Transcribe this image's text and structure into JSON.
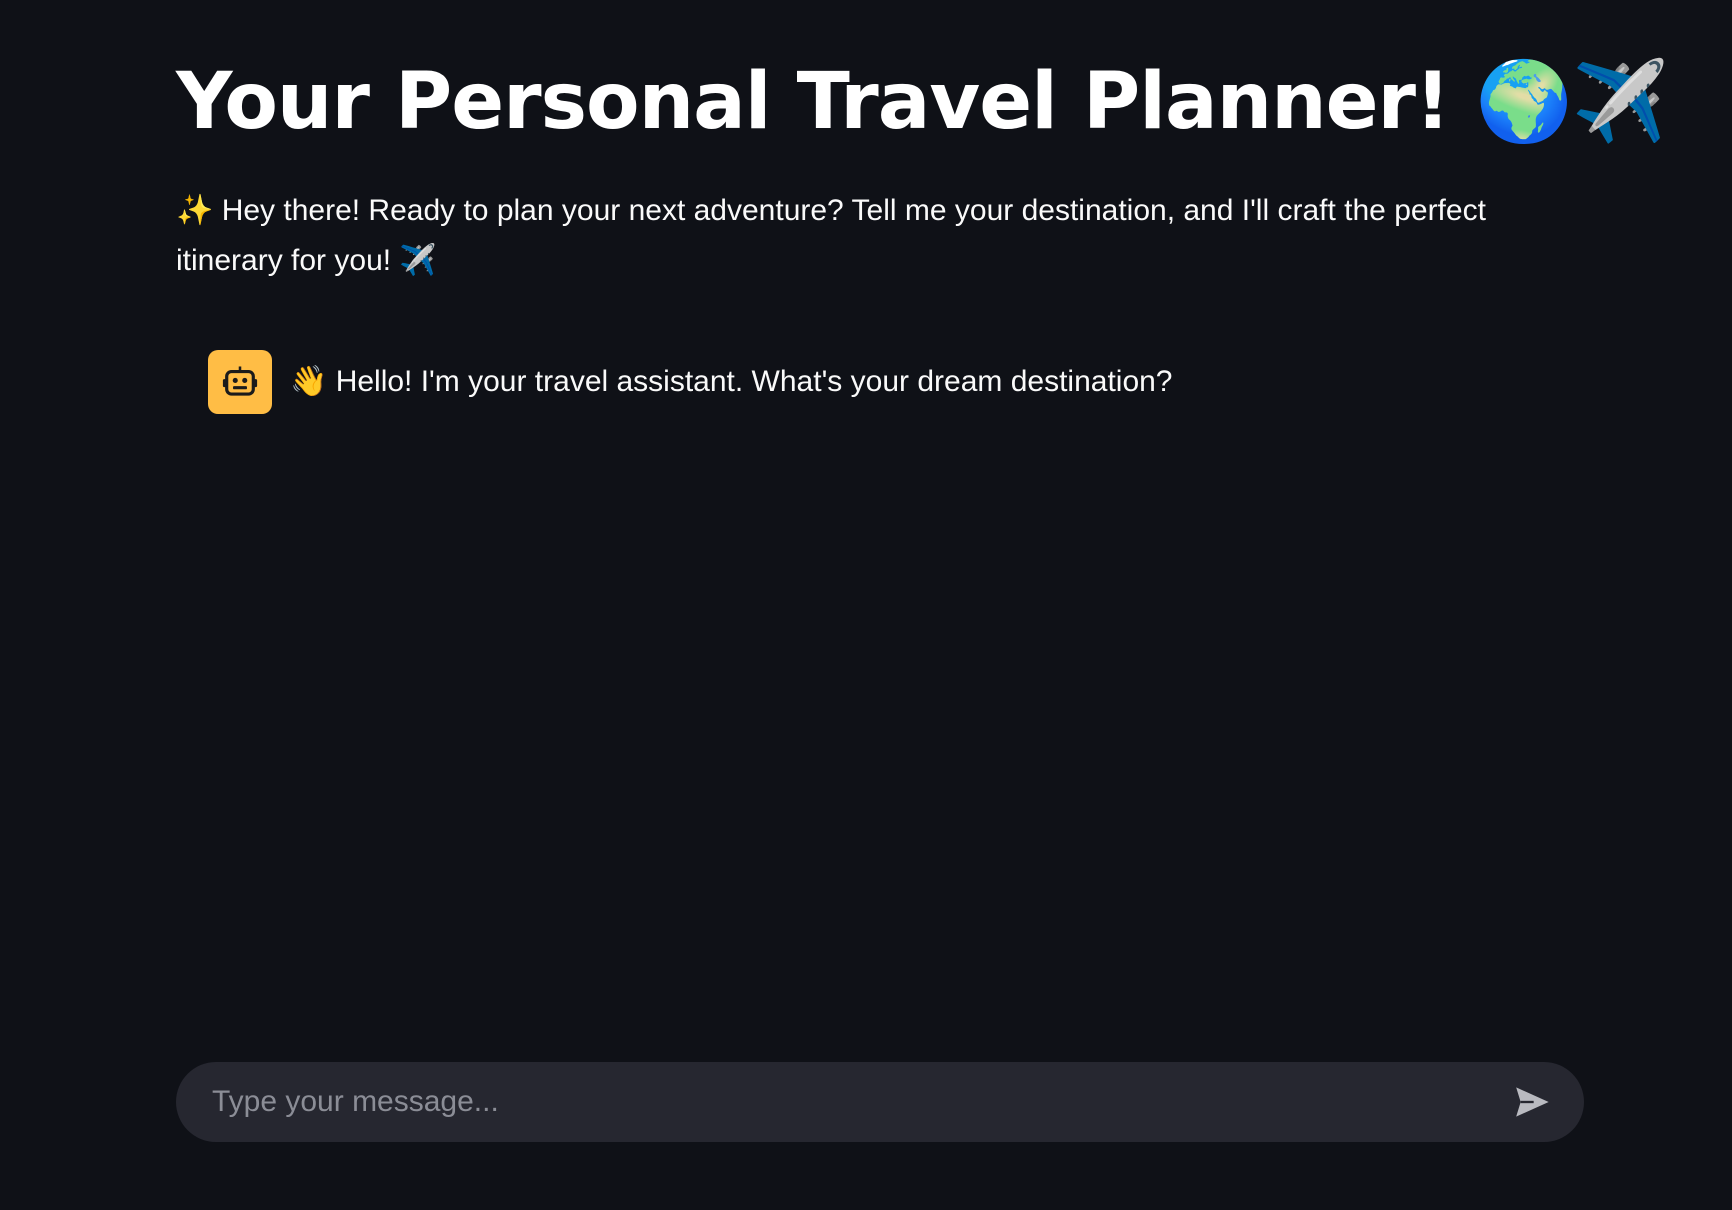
{
  "header": {
    "title": "Your Personal Travel Planner! 🌍✈️"
  },
  "intro": {
    "text": "✨ Hey there! Ready to plan your next adventure? Tell me your destination, and I'll craft the perfect itinerary for you! ✈️"
  },
  "chat": {
    "messages": [
      {
        "role": "assistant",
        "avatar_icon": "robot-icon",
        "avatar_color": "#ffbd45",
        "text": "👋 Hello! I'm your travel assistant. What's your dream destination?"
      }
    ],
    "input": {
      "placeholder": "Type your message...",
      "value": ""
    },
    "send_icon": "send-icon"
  },
  "colors": {
    "background": "#0f1117",
    "input_background": "#262730",
    "text": "#fafafa",
    "accent": "#ffbd45"
  }
}
